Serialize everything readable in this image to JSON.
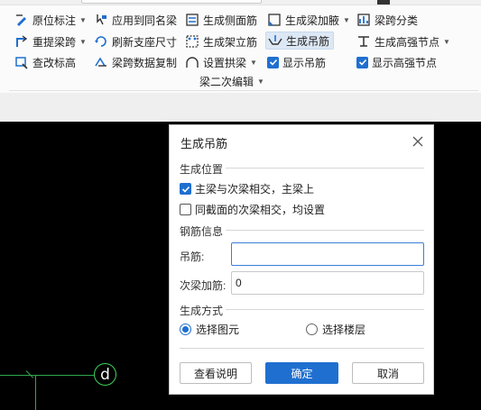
{
  "ribbon": {
    "col1": [
      {
        "label": "原位标注",
        "icon": "original-annotation-icon",
        "caret": true
      },
      {
        "label": "重提梁跨",
        "icon": "re-extract-span-icon",
        "caret": true
      },
      {
        "label": "查改标高",
        "icon": "check-elevation-icon",
        "caret": false
      }
    ],
    "col2": [
      {
        "label": "应用到同名梁",
        "icon": "apply-same-name-icon"
      },
      {
        "label": "刷新支座尺寸",
        "icon": "refresh-support-icon"
      },
      {
        "label": "梁跨数据复制",
        "icon": "copy-span-data-icon"
      }
    ],
    "col3": [
      {
        "label": "生成侧面筋",
        "icon": "side-rebar-icon",
        "caret": false
      },
      {
        "label": "生成架立筋",
        "icon": "erection-rebar-icon",
        "caret": false
      },
      {
        "label": "设置拱梁",
        "icon": "arch-beam-icon",
        "caret": true
      }
    ],
    "col4": [
      {
        "label": "生成梁加腋",
        "icon": "beam-haunch-icon",
        "caret": true
      },
      {
        "label": "生成吊筋",
        "icon": "hanger-rebar-icon",
        "active": true
      },
      {
        "label": "显示吊筋",
        "checkbox": true
      }
    ],
    "col5": [
      {
        "label": "梁跨分类",
        "icon": "span-classify-icon",
        "caret": false
      },
      {
        "label": "生成高强节点",
        "icon": "high-strength-node-icon",
        "caret": true
      },
      {
        "label": "显示高强节点",
        "checkbox": true
      }
    ],
    "group_label": "梁二次编辑"
  },
  "canvas": {
    "axis_label": "d"
  },
  "dialog": {
    "title": "生成吊筋",
    "section_position": "生成位置",
    "option_main_secondary": "主梁与次梁相交，主梁上",
    "option_main_secondary_checked": true,
    "option_same_section": "同截面的次梁相交，均设置",
    "option_same_section_checked": false,
    "section_rebar": "钢筋信息",
    "hanger_label": "吊筋:",
    "hanger_value": "",
    "secondary_label": "次梁加筋:",
    "secondary_value": "0",
    "section_method": "生成方式",
    "radio_select_element": "选择图元",
    "radio_select_floor": "选择楼层",
    "selected_method": "选择图元",
    "btn_help": "查看说明",
    "btn_ok": "确定",
    "btn_cancel": "取消",
    "accent_color": "#1f6fd0"
  }
}
